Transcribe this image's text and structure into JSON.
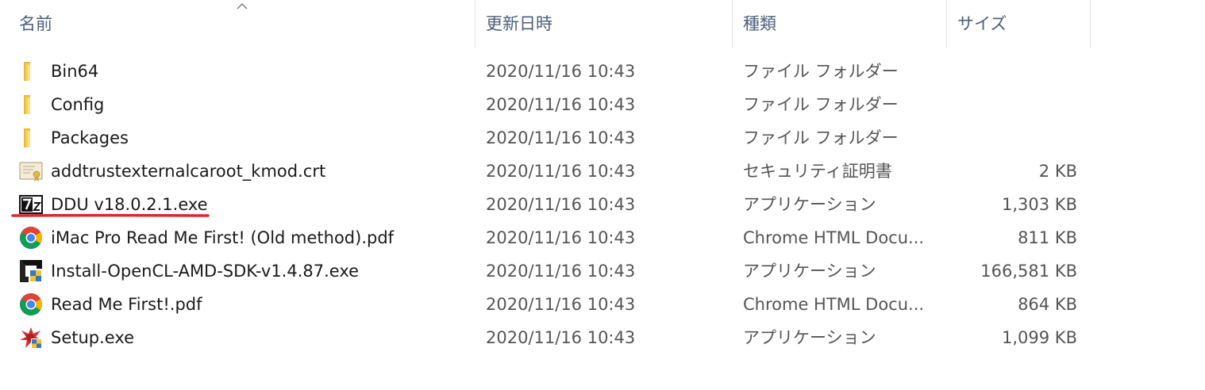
{
  "columns": {
    "name": "名前",
    "date": "更新日時",
    "type": "種類",
    "size": "サイズ"
  },
  "files": [
    {
      "name": "Bin64",
      "date": "2020/11/16 10:43",
      "type": "ファイル フォルダー",
      "size": "",
      "icon": "folder-icon"
    },
    {
      "name": "Config",
      "date": "2020/11/16 10:43",
      "type": "ファイル フォルダー",
      "size": "",
      "icon": "folder-icon"
    },
    {
      "name": "Packages",
      "date": "2020/11/16 10:43",
      "type": "ファイル フォルダー",
      "size": "",
      "icon": "folder-icon"
    },
    {
      "name": "addtrustexternalcaroot_kmod.crt",
      "date": "2020/11/16 10:43",
      "type": "セキュリティ証明書",
      "size": "2 KB",
      "icon": "certificate-icon"
    },
    {
      "name": "DDU v18.0.2.1.exe",
      "date": "2020/11/16 10:43",
      "type": "アプリケーション",
      "size": "1,303 KB",
      "icon": "7zip-icon"
    },
    {
      "name": "iMac Pro Read Me First! (Old method).pdf",
      "date": "2020/11/16 10:43",
      "type": "Chrome HTML Docu...",
      "size": "811 KB",
      "icon": "chrome-icon"
    },
    {
      "name": "Install-OpenCL-AMD-SDK-v1.4.87.exe",
      "date": "2020/11/16 10:43",
      "type": "アプリケーション",
      "size": "166,581 KB",
      "icon": "amd-installer-icon"
    },
    {
      "name": "Read Me First!.pdf",
      "date": "2020/11/16 10:43",
      "type": "Chrome HTML Docu...",
      "size": "864 KB",
      "icon": "chrome-icon"
    },
    {
      "name": "Setup.exe",
      "date": "2020/11/16 10:43",
      "type": "アプリケーション",
      "size": "1,099 KB",
      "icon": "setup-installer-icon"
    }
  ],
  "colors": {
    "header_text": "#4c607a",
    "folder": "#f5c84c",
    "annotation_underline": "#d92a2a"
  }
}
